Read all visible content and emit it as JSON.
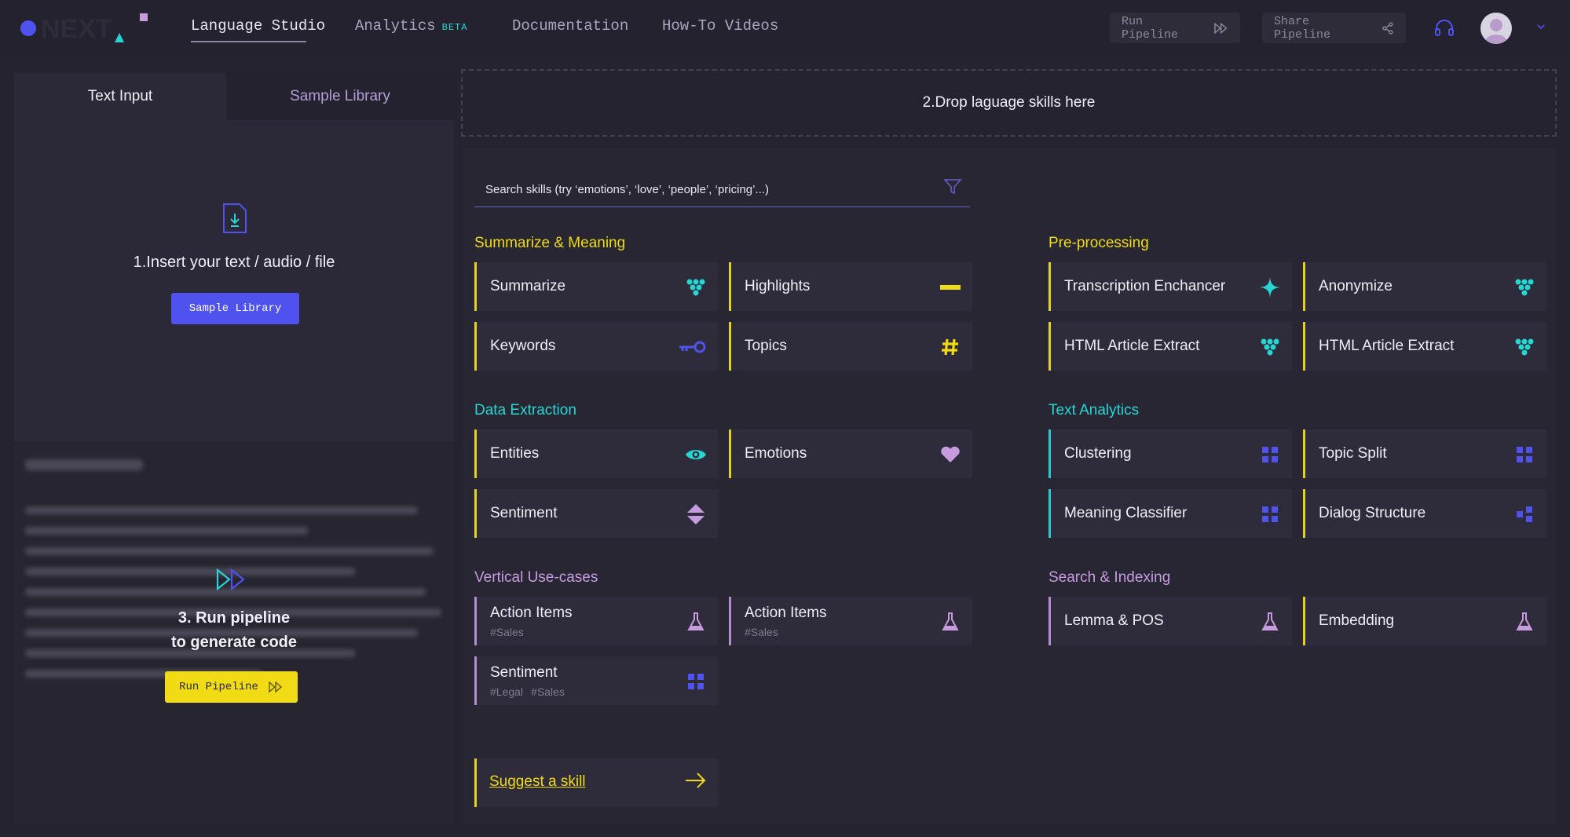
{
  "topbar": {
    "nav": [
      {
        "label": "Language Studio",
        "active": true
      },
      {
        "label": "Analytics",
        "badge": "BETA"
      },
      {
        "label": "Documentation"
      },
      {
        "label": "How-To Videos"
      }
    ],
    "run_pipeline_label": "Run Pipeline",
    "share_pipeline_label": "Share Pipeline",
    "icons": [
      "headset-icon",
      "avatar",
      "chevron-down-icon"
    ]
  },
  "left": {
    "tabs": [
      {
        "label": "Text Input"
      },
      {
        "label": "Sample Library"
      }
    ],
    "insert_title": "1.Insert your text / audio / file",
    "sample_button": "Sample Library",
    "run_title_1": "3. Run pipeline",
    "run_title_2": "to generate code",
    "run_button": "Run Pipeline"
  },
  "dropzone": {
    "label": "2.Drop laguage skills here"
  },
  "search": {
    "placeholder": "Search skills (try ‘emotions’, ‘love’, ‘people’, ‘pricing’...)"
  },
  "categories": {
    "summarize": {
      "title": "Summarize & Meaning",
      "color": "#f0db14",
      "items": [
        {
          "label": "Summarize",
          "icon": "grapes-icon"
        },
        {
          "label": "Highlights",
          "icon": "minus-icon"
        },
        {
          "label": "Keywords",
          "icon": "key-icon"
        },
        {
          "label": "Topics",
          "icon": "hashtag-icon"
        }
      ]
    },
    "preprocessing": {
      "title": "Pre-processing",
      "color": "#f0db14",
      "items": [
        {
          "label": "Transcription Enchancer",
          "icon": "sparkle-icon"
        },
        {
          "label": "Anonymize",
          "icon": "grapes-icon"
        },
        {
          "label": "HTML Article Extract",
          "icon": "grapes-icon"
        },
        {
          "label": "HTML Article Extract",
          "icon": "grapes-icon"
        }
      ]
    },
    "extraction": {
      "title": "Data Extraction",
      "color": "#27d6d2",
      "items": [
        {
          "label": "Entities",
          "icon": "eye-icon"
        },
        {
          "label": "Emotions",
          "icon": "heart-icon"
        },
        {
          "label": "Sentiment",
          "icon": "sort-arrows-icon"
        }
      ]
    },
    "analytics": {
      "title": "Text Analytics",
      "color": "#27d6d2",
      "items": [
        {
          "label": "Clustering",
          "icon": "grid-icon"
        },
        {
          "label": "Topic Split",
          "icon": "grid-icon"
        },
        {
          "label": "Meaning Classifier",
          "icon": "grid-icon"
        },
        {
          "label": "Dialog Structure",
          "icon": "blocks-icon"
        }
      ]
    },
    "vertical": {
      "title": "Vertical Use-cases",
      "color": "#c79be0",
      "items": [
        {
          "label": "Action Items",
          "tags": [
            "#Sales"
          ],
          "icon": "flask-icon"
        },
        {
          "label": "Action Items",
          "tags": [
            "#Sales"
          ],
          "icon": "flask-icon"
        },
        {
          "label": "Sentiment",
          "tags": [
            "#Legal",
            "#Sales"
          ],
          "icon": "grid-icon"
        }
      ]
    },
    "search": {
      "title": "Search & Indexing",
      "color": "#c79be0",
      "items": [
        {
          "label": "Lemma & POS",
          "icon": "flask-icon"
        },
        {
          "label": "Embedding",
          "icon": "flask-icon"
        }
      ]
    }
  },
  "suggest": {
    "label": "Suggest a skill"
  }
}
